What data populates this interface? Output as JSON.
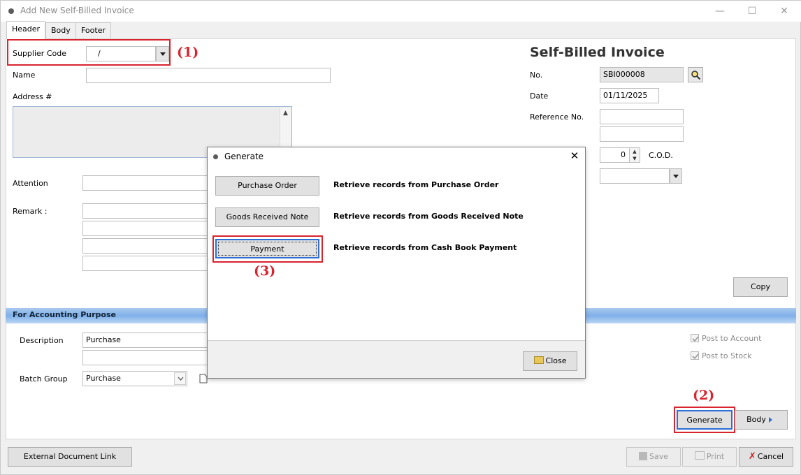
{
  "window": {
    "title": "Add New Self-Billed Invoice",
    "minimize": "—",
    "maximize": "☐",
    "close": "✕"
  },
  "tabs": [
    "Header",
    "Body",
    "Footer"
  ],
  "header": {
    "supplier_code_label": "Supplier Code",
    "supplier_code_value": "/",
    "name_label": "Name",
    "address_label": "Address #",
    "attention_label": "Attention",
    "remark_label": "Remark :",
    "doc_title": "Self-Billed Invoice",
    "no_label": "No.",
    "no_value": "SBI000008",
    "date_label": "Date",
    "date_value": "01/11/2025",
    "ref_label": "Reference No.",
    "terms_value": "0",
    "terms_suffix": "C.O.D.",
    "copy_label": "Copy"
  },
  "accounting": {
    "section_title": "For Accounting Purpose",
    "description_label": "Description",
    "description_value": "Purchase",
    "batch_group_label": "Batch Group",
    "batch_group_value": "Purchase",
    "post_to_account": "Post to Account",
    "post_to_stock": "Post to Stock"
  },
  "actions": {
    "generate": "Generate",
    "body": "Body",
    "external_link": "External Document Link",
    "save": "Save",
    "print": "Print",
    "cancel": "Cancel"
  },
  "modal": {
    "title": "Generate",
    "close_x": "✕",
    "rows": [
      {
        "button": "Purchase Order",
        "desc": "Retrieve records from Purchase Order"
      },
      {
        "button": "Goods Received Note",
        "desc": "Retrieve records from Goods Received Note"
      },
      {
        "button": "Payment",
        "desc": "Retrieve records from Cash Book Payment"
      }
    ],
    "close_button": "Close"
  },
  "annotations": [
    "(1)",
    "(2)",
    "(3)"
  ],
  "colors": {
    "annotation_red": "#d9232e",
    "section_blue": "#7fb0e8",
    "focus_blue": "#2d6fd6"
  }
}
